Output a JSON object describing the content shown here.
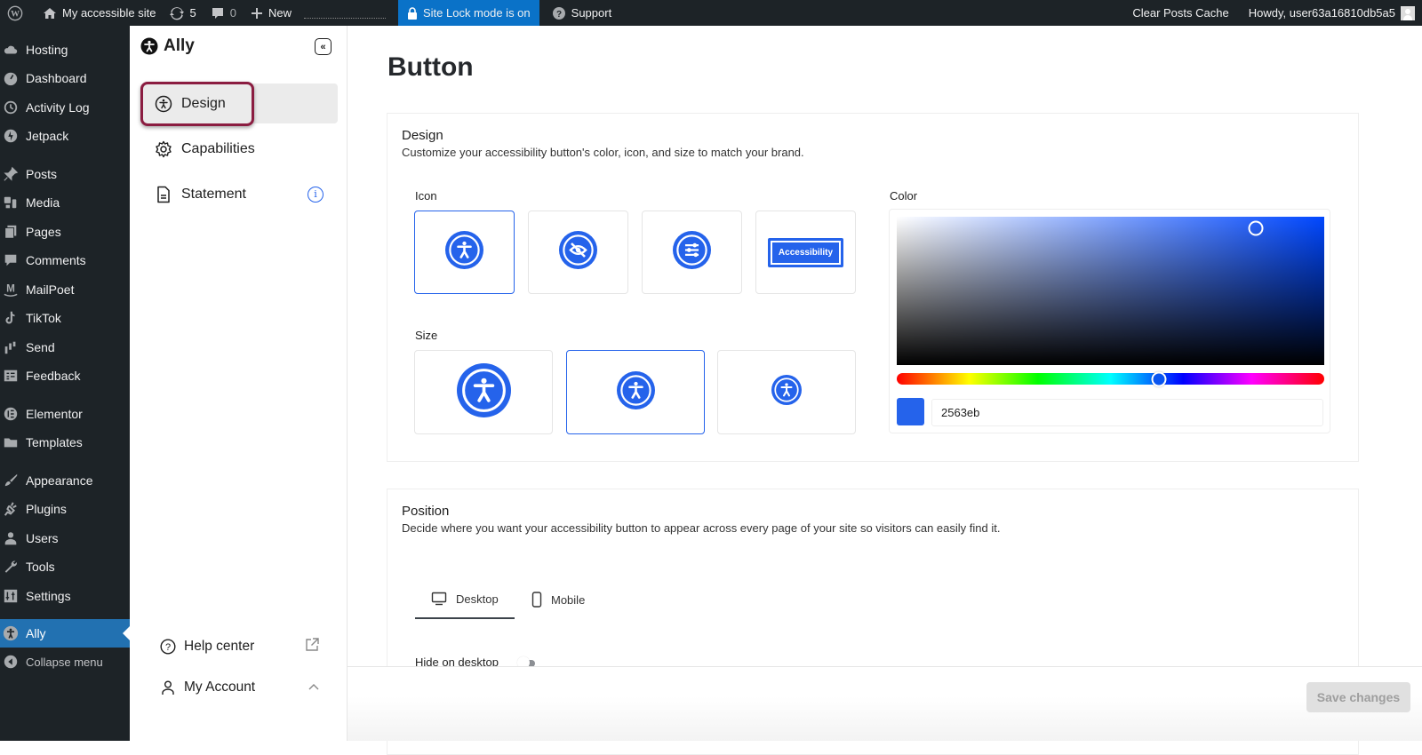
{
  "adminbar": {
    "site_name": "My accessible site",
    "updates_count": "5",
    "comments_count": "0",
    "new_label": "New",
    "site_lock_label": "Site Lock mode is on",
    "support_label": "Support",
    "clear_cache_label": "Clear Posts Cache",
    "howdy_label": "Howdy, user63a16810db5a5"
  },
  "wp_menu": {
    "items": [
      {
        "label": "Hosting",
        "icon": "cloud-icon"
      },
      {
        "label": "Dashboard",
        "icon": "dashboard-icon"
      },
      {
        "label": "Activity Log",
        "icon": "history-icon"
      },
      {
        "label": "Jetpack",
        "icon": "jetpack-icon"
      },
      {
        "label": "Posts",
        "icon": "pin-icon"
      },
      {
        "label": "Media",
        "icon": "media-icon"
      },
      {
        "label": "Pages",
        "icon": "pages-icon"
      },
      {
        "label": "Comments",
        "icon": "comment-icon"
      },
      {
        "label": "MailPoet",
        "icon": "mailpoet-icon"
      },
      {
        "label": "TikTok",
        "icon": "tiktok-icon"
      },
      {
        "label": "Send",
        "icon": "send-icon"
      },
      {
        "label": "Feedback",
        "icon": "feedback-icon"
      },
      {
        "label": "Elementor",
        "icon": "elementor-icon"
      },
      {
        "label": "Templates",
        "icon": "folder-icon"
      },
      {
        "label": "Appearance",
        "icon": "brush-icon"
      },
      {
        "label": "Plugins",
        "icon": "plugin-icon"
      },
      {
        "label": "Users",
        "icon": "user-icon"
      },
      {
        "label": "Tools",
        "icon": "wrench-icon"
      },
      {
        "label": "Settings",
        "icon": "settings-icon"
      },
      {
        "label": "Ally",
        "icon": "accessibility-icon",
        "active": true
      }
    ],
    "collapse_label": "Collapse menu"
  },
  "ally_sidebar": {
    "brand": "Ally",
    "nav": [
      {
        "label": "Design",
        "selected": true
      },
      {
        "label": "Capabilities"
      },
      {
        "label": "Statement",
        "info_badge": "i"
      }
    ],
    "help_center_label": "Help center",
    "my_account_label": "My Account"
  },
  "main": {
    "title": "Button",
    "design_card": {
      "heading": "Design",
      "subtitle": "Customize your accessibility button's color, icon, and size to match your brand.",
      "icon_label": "Icon",
      "icon_options": [
        {
          "name": "person-icon",
          "selected": true
        },
        {
          "name": "eye-slash-icon",
          "selected": false
        },
        {
          "name": "sliders-icon",
          "selected": false
        },
        {
          "name": "text-badge",
          "text": "Accessibility",
          "selected": false
        }
      ],
      "size_label": "Size",
      "size_options": [
        {
          "name": "large",
          "selected": false
        },
        {
          "name": "medium",
          "selected": true
        },
        {
          "name": "small",
          "selected": false
        }
      ],
      "color_label": "Color",
      "color_hex": "2563eb",
      "color_value": "#2563eb",
      "hue_degrees": 221,
      "saturation_percent": 84,
      "brightness_percent": 92
    },
    "position_card": {
      "heading": "Position",
      "subtitle": "Decide where you want your accessibility button to appear across every page of your site so visitors can easily find it.",
      "tabs": [
        {
          "label": "Desktop",
          "selected": true
        },
        {
          "label": "Mobile",
          "selected": false
        }
      ],
      "hide_label": "Hide on desktop",
      "hide_enabled": false
    }
  },
  "footer": {
    "save_label": "Save changes"
  },
  "colors": {
    "accent": "#2563eb",
    "wp_active": "#2271b1",
    "site_lock": "#0a72c8",
    "highlight": "#8b1d41"
  }
}
